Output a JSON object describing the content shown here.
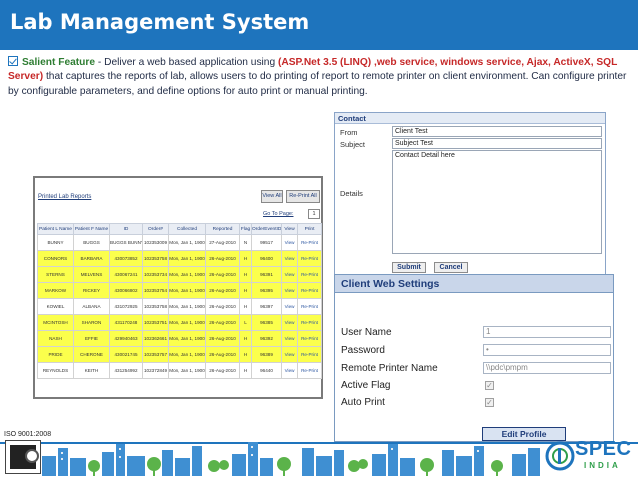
{
  "header": {
    "title": "Lab Management System"
  },
  "feature": {
    "label": "Salient Feature",
    "dash": " - ",
    "text_before": "Deliver a web based application using ",
    "tech": "(ASP.Net 3.5 (LINQ) ,web service, windows service, Ajax, ActiveX, SQL Server)",
    "text_after": " that captures the reports of lab, allows users to do printing of report to remote printer on client environment. Can configure printer by configurable parameters, and define options for auto print or manual printing."
  },
  "contact": {
    "title": "Contact",
    "from_label": "From",
    "from_value": "Client Test",
    "subject_label": "Subject",
    "subject_value": "Subject Test",
    "details_label": "Details",
    "details_value": "Contact Detail here",
    "submit_label": "Submit",
    "cancel_label": "Cancel"
  },
  "client_settings": {
    "title": "Client Web Settings",
    "username_label": "User Name",
    "username_value": "1",
    "password_label": "Password",
    "password_value": "•",
    "printer_label": "Remote Printer Name",
    "printer_value": "\\\\pdc\\pmpm",
    "active_label": "Active Flag",
    "autoprint_label": "Auto Print",
    "check_mark": "✓",
    "edit_label": "Edit Profile"
  },
  "reports": {
    "title": "Printed Lab Reports",
    "view_all": "View All",
    "reprint_all": "Re-Print All",
    "goto_label": "Go To Page:",
    "page_value": "1",
    "columns": [
      "Patient L Name",
      "Patient F Name",
      "ID",
      "Order#",
      "Collected",
      "Reported",
      "Flag",
      "OrderEventID",
      "View",
      "Print"
    ],
    "rows": [
      [
        "BUNNY",
        "BUGGS",
        "BUGGS BUNNY",
        "102353009",
        "Mon, Jan 1, 1900",
        "27-Aug-2010",
        "N",
        "99517",
        "View",
        "Re-Print"
      ],
      [
        "CONNORS",
        "BARBARA",
        "430073852",
        "102353758",
        "Mon, Jan 1, 1900",
        "26-Aug-2010",
        "H",
        "96400",
        "View",
        "Re-Print"
      ],
      [
        "STERNS",
        "MELVENS",
        "430067241",
        "102353734",
        "Mon, Jan 1, 1900",
        "26-Aug-2010",
        "H",
        "96391",
        "View",
        "Re-Print"
      ],
      [
        "MARKOW",
        "RICKEY",
        "430066802",
        "102353754",
        "Mon, Jan 1, 1900",
        "26-Aug-2010",
        "H",
        "96395",
        "View",
        "Re-Print"
      ],
      [
        "KOWIEL",
        "ALBANA",
        "431072925",
        "102353758",
        "Mon, Jan 1, 1900",
        "26-Aug-2010",
        "H",
        "96397",
        "View",
        "Re-Print"
      ],
      [
        "MCINTOSH",
        "SHARON",
        "431170248",
        "102353751",
        "Mon, Jan 1, 1900",
        "26-Aug-2010",
        "L",
        "96385",
        "View",
        "Re-Print"
      ],
      [
        "NASH",
        "EFFIE",
        "429940463",
        "102362661",
        "Mon, Jan 1, 1900",
        "26-Aug-2010",
        "H",
        "96392",
        "View",
        "Re-Print"
      ],
      [
        "PRIDE",
        "CHERONE",
        "430021745",
        "102353757",
        "Mon, Jan 1, 1900",
        "26-Aug-2010",
        "H",
        "96389",
        "View",
        "Re-Print"
      ],
      [
        "REYNOLDS",
        "KEITH",
        "431254992",
        "102372849",
        "Mon, Jan 1, 1900",
        "26-Aug-2010",
        "H",
        "96440",
        "View",
        "Re-Print"
      ]
    ],
    "highlighted_rows": [
      1,
      2,
      3,
      5,
      6,
      7
    ]
  },
  "footer": {
    "iso": "ISO 9001:2008",
    "brand": "SPEC",
    "country": "INDIA"
  },
  "colors": {
    "header_bg": "#1e74bd",
    "highlight_row": "#fbff4c",
    "feature_label": "#2e7d32",
    "tech_text": "#c62828"
  }
}
